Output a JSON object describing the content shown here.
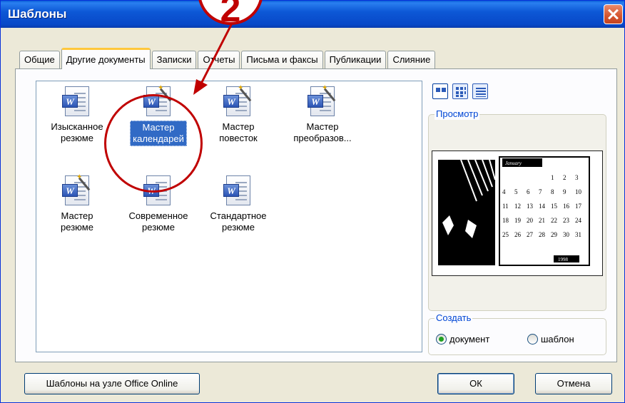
{
  "window": {
    "title": "Шаблоны"
  },
  "tabs": [
    {
      "label": "Общие",
      "active": false
    },
    {
      "label": "Другие документы",
      "active": true
    },
    {
      "label": "Записки",
      "active": false
    },
    {
      "label": "Отчеты",
      "active": false
    },
    {
      "label": "Письма и факсы",
      "active": false
    },
    {
      "label": "Публикации",
      "active": false
    },
    {
      "label": "Слияние",
      "active": false
    }
  ],
  "templates": [
    {
      "line1": "Изысканное",
      "line2": "резюме",
      "selected": false
    },
    {
      "line1": "Мастер",
      "line2": "календарей",
      "selected": true
    },
    {
      "line1": "Мастер",
      "line2": "повесток",
      "selected": false
    },
    {
      "line1": "Мастер",
      "line2": "преобразов...",
      "selected": false
    },
    {
      "line1": "Мастер",
      "line2": "резюме",
      "selected": false
    },
    {
      "line1": "Современное",
      "line2": "резюме",
      "selected": false
    },
    {
      "line1": "Стандартное",
      "line2": "резюме",
      "selected": false
    }
  ],
  "preview": {
    "legend": "Просмотр",
    "calendar": {
      "month": "January",
      "year": "1998",
      "rows": [
        [
          "",
          "",
          "",
          "",
          "1",
          "2",
          "3"
        ],
        [
          "4",
          "5",
          "6",
          "7",
          "8",
          "9",
          "10"
        ],
        [
          "11",
          "12",
          "13",
          "14",
          "15",
          "16",
          "17"
        ],
        [
          "18",
          "19",
          "20",
          "21",
          "22",
          "23",
          "24"
        ],
        [
          "25",
          "26",
          "27",
          "28",
          "29",
          "30",
          "31"
        ]
      ]
    }
  },
  "create": {
    "legend": "Создать",
    "option_document": "документ",
    "option_template": "шаблон",
    "selected": "document"
  },
  "buttons": {
    "online": "Шаблоны на узле Office Online",
    "ok": "ОК",
    "cancel": "Отмена"
  },
  "annotation": {
    "step": "2"
  },
  "colors": {
    "titlebar": "#0a52d4",
    "selection": "#316ac5",
    "annotation": "#c00000",
    "tab_highlight": "#ffc83c"
  }
}
